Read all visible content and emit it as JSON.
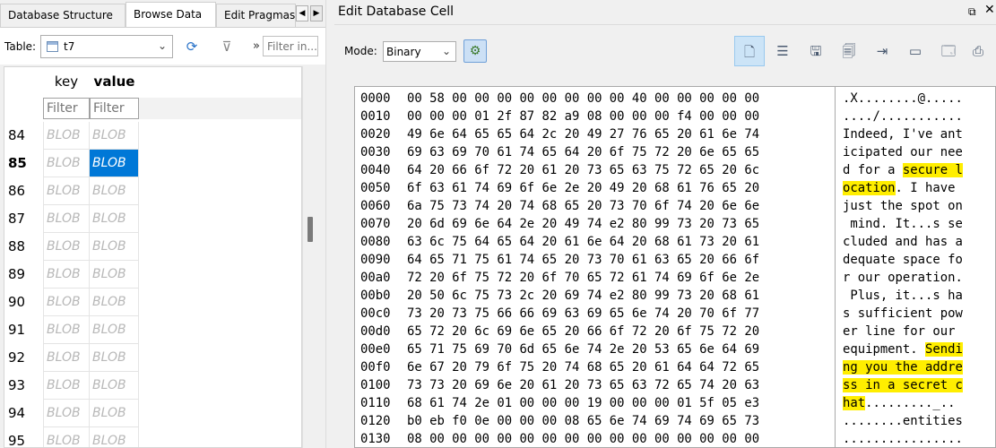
{
  "left_tabs": [
    {
      "label": "Database Structure"
    },
    {
      "label": "Browse Data"
    },
    {
      "label": "Edit Pragmas"
    }
  ],
  "table_bar": {
    "label": "Table:",
    "selected_table": "t7",
    "filter_placeholder": "Filter in..."
  },
  "grid": {
    "columns": [
      "key",
      "value"
    ],
    "filter_placeholder": "Filter",
    "rows": [
      {
        "num": "84",
        "key": "BLOB",
        "value": "BLOB"
      },
      {
        "num": "85",
        "key": "BLOB",
        "value": "BLOB"
      },
      {
        "num": "86",
        "key": "BLOB",
        "value": "BLOB"
      },
      {
        "num": "87",
        "key": "BLOB",
        "value": "BLOB"
      },
      {
        "num": "88",
        "key": "BLOB",
        "value": "BLOB"
      },
      {
        "num": "89",
        "key": "BLOB",
        "value": "BLOB"
      },
      {
        "num": "90",
        "key": "BLOB",
        "value": "BLOB"
      },
      {
        "num": "91",
        "key": "BLOB",
        "value": "BLOB"
      },
      {
        "num": "92",
        "key": "BLOB",
        "value": "BLOB"
      },
      {
        "num": "93",
        "key": "BLOB",
        "value": "BLOB"
      },
      {
        "num": "94",
        "key": "BLOB",
        "value": "BLOB"
      },
      {
        "num": "95",
        "key": "BLOB",
        "value": "BLOB"
      }
    ],
    "current_row": "85"
  },
  "editor": {
    "title": "Edit Database Cell",
    "mode_label": "Mode:",
    "mode_value": "Binary",
    "highlight_color": "#ffee00",
    "selection_color": "#0078d7",
    "hex_lines": [
      {
        "offset": "0000",
        "hex": "00 58 00 00 00 00 00 00 00 00 40 00 00 00 00 00",
        "ascii": [
          {
            "t": ".X........@....."
          }
        ]
      },
      {
        "offset": "0010",
        "hex": "00 00 00 01 2f 87 82 a9 08 00 00 00 f4 00 00 00",
        "ascii": [
          {
            "t": "..../..........."
          }
        ]
      },
      {
        "offset": "0020",
        "hex": "49 6e 64 65 65 64 2c 20 49 27 76 65 20 61 6e 74",
        "ascii": [
          {
            "t": "Indeed, I've ant"
          }
        ]
      },
      {
        "offset": "0030",
        "hex": "69 63 69 70 61 74 65 64 20 6f 75 72 20 6e 65 65",
        "ascii": [
          {
            "t": "icipated our nee"
          }
        ]
      },
      {
        "offset": "0040",
        "hex": "64 20 66 6f 72 20 61 20 73 65 63 75 72 65 20 6c",
        "ascii": [
          {
            "t": "d for a "
          },
          {
            "t": "secure l",
            "h": true
          }
        ]
      },
      {
        "offset": "0050",
        "hex": "6f 63 61 74 69 6f 6e 2e 20 49 20 68 61 76 65 20",
        "ascii": [
          {
            "t": "ocation",
            "h": true
          },
          {
            "t": ". I have "
          }
        ]
      },
      {
        "offset": "0060",
        "hex": "6a 75 73 74 20 74 68 65 20 73 70 6f 74 20 6e 6e",
        "ascii": [
          {
            "t": "just the spot on"
          }
        ]
      },
      {
        "offset": "0070",
        "hex": "20 6d 69 6e 64 2e 20 49 74 e2 80 99 73 20 73 65",
        "ascii": [
          {
            "t": " mind. It...s se"
          }
        ]
      },
      {
        "offset": "0080",
        "hex": "63 6c 75 64 65 64 20 61 6e 64 20 68 61 73 20 61",
        "ascii": [
          {
            "t": "cluded and has a"
          }
        ]
      },
      {
        "offset": "0090",
        "hex": "64 65 71 75 61 74 65 20 73 70 61 63 65 20 66 6f",
        "ascii": [
          {
            "t": "dequate space fo"
          }
        ]
      },
      {
        "offset": "00a0",
        "hex": "72 20 6f 75 72 20 6f 70 65 72 61 74 69 6f 6e 2e",
        "ascii": [
          {
            "t": "r our operation."
          }
        ]
      },
      {
        "offset": "00b0",
        "hex": "20 50 6c 75 73 2c 20 69 74 e2 80 99 73 20 68 61",
        "ascii": [
          {
            "t": " Plus, it...s ha"
          }
        ]
      },
      {
        "offset": "00c0",
        "hex": "73 20 73 75 66 66 69 63 69 65 6e 74 20 70 6f 77",
        "ascii": [
          {
            "t": "s sufficient pow"
          }
        ]
      },
      {
        "offset": "00d0",
        "hex": "65 72 20 6c 69 6e 65 20 66 6f 72 20 6f 75 72 20",
        "ascii": [
          {
            "t": "er line for our "
          }
        ]
      },
      {
        "offset": "00e0",
        "hex": "65 71 75 69 70 6d 65 6e 74 2e 20 53 65 6e 64 69",
        "ascii": [
          {
            "t": "equipment. "
          },
          {
            "t": "Sendi",
            "h": true
          }
        ]
      },
      {
        "offset": "00f0",
        "hex": "6e 67 20 79 6f 75 20 74 68 65 20 61 64 64 72 65",
        "ascii": [
          {
            "t": "ng you the addre",
            "h": true
          }
        ]
      },
      {
        "offset": "0100",
        "hex": "73 73 20 69 6e 20 61 20 73 65 63 72 65 74 20 63",
        "ascii": [
          {
            "t": "ss in a secret c",
            "h": true
          }
        ]
      },
      {
        "offset": "0110",
        "hex": "68 61 74 2e 01 00 00 00 19 00 00 00 01 5f 05 e3",
        "ascii": [
          {
            "t": "hat",
            "h": true
          },
          {
            "t": "........._.."
          }
        ]
      },
      {
        "offset": "0120",
        "hex": "b0 eb f0 0e 00 00 00 08 65 6e 74 69 74 69 65 73",
        "ascii": [
          {
            "t": "........entities"
          }
        ]
      },
      {
        "offset": "0130",
        "hex": "08 00 00 00 00 00 00 00 00 00 00 00 00 00 00 00",
        "ascii": [
          {
            "t": "................"
          }
        ]
      }
    ]
  }
}
